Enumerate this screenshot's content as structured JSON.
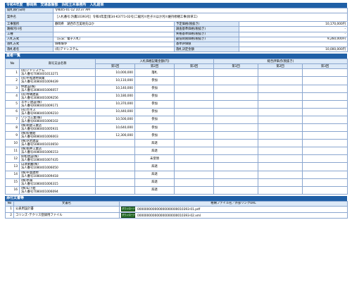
{
  "page_title": "令和4年度　静岡県　交通基盤部　浜松土木事務所　入札結果",
  "info": {
    "rows": [
      {
        "l1": "開札執行日時",
        "v1": "令和05-01-12 10:37 AM",
        "l2": "",
        "v2": "",
        "span": true
      },
      {
        "l1": "案件名",
        "v1": "［入札番号:浜農10393号］令和4年度[第34-K3771-02号]二級河川世子川ほか河川維持修繕工事(除草工)",
        "l2": "",
        "v2": "",
        "span": true,
        "tall": true
      },
      {
        "l1": "工事箇所",
        "v1": "静岡県　湖西市吉美地先ほか",
        "l2": "予定価格(税抜き)",
        "v2": "10,170,000円"
      },
      {
        "l1": "路線河川名",
        "v1": "",
        "l2": "調査基準価格(税抜き)",
        "v2": "-"
      },
      {
        "l1": "工種",
        "v1": "",
        "l2": "失格基準価格(税抜き)",
        "v2": "-"
      },
      {
        "l1": "入札方式",
        "v1": "（方法：電子入札）",
        "l2": "最低制限価格(税抜き)",
        "v2": "9,260,000円"
      },
      {
        "l1": "落札方式",
        "v1": "価格競争",
        "l2": "基準評価値",
        "v2": ""
      },
      {
        "l1": "落札者名",
        "v1": "(有)アドシステム",
        "l2": "落札決定金額",
        "v2": "10,000,000円"
      }
    ]
  },
  "bidders_section": {
    "title": "業者一覧",
    "col_no": "No",
    "col_name": "商号又は名称",
    "col_bid_group": "入札価格記載金額(円)",
    "col_eval_group": "総合評価点(税抜き)",
    "col_first": "第1回",
    "col_second": "第2回",
    "col_third": "第3回",
    "rows": [
      {
        "no": "1",
        "name": "(有)アドシステム",
        "corp": "法人番号7080401013271",
        "amount": "10,000,000",
        "result": "落札"
      },
      {
        "no": "2",
        "name": "(有)平松建材興業",
        "corp": "法人番号3080401009439",
        "amount": "10,110,000",
        "result": "参加"
      },
      {
        "no": "3",
        "name": "伸建設(株)",
        "corp": "法人番号3080401006057",
        "amount": "10,140,000",
        "result": "参加"
      },
      {
        "no": "4",
        "name": "(有)寺嶋建築",
        "corp": "法人番号3080401009256",
        "amount": "10,180,000",
        "result": "参加"
      },
      {
        "no": "5",
        "name": "エボシ建設(株)",
        "corp": "法人番号6080401009171",
        "amount": "10,370,000",
        "result": "参加"
      },
      {
        "no": "6",
        "name": "(有)カネス",
        "corp": "法人番号9080401009210",
        "amount": "10,440,000",
        "result": "参加"
      },
      {
        "no": "7",
        "name": "ワンゴ工業(株)",
        "corp": "法人番号6080401006102",
        "amount": "10,500,000",
        "result": "参加"
      },
      {
        "no": "8",
        "name": "(株)岡倉工業店",
        "corp": "法人番号6080401005931",
        "amount": "10,640,000",
        "result": "参加"
      },
      {
        "no": "9",
        "name": "(株)鈴嘉組",
        "corp": "法人番号8080401006003",
        "amount": "12,300,000",
        "result": "参加"
      },
      {
        "no": "10",
        "name": "(株)浜岩建設",
        "corp": "法人番号5080401010650",
        "amount": "",
        "result": "辞退"
      },
      {
        "no": "11",
        "name": "(株)角井工業店",
        "corp": "法人番号4080401006153",
        "amount": "",
        "result": "辞退"
      },
      {
        "no": "12",
        "name": "鈴松建設(株)",
        "corp": "法人番号1080401007435",
        "amount": "",
        "result": "未受領"
      },
      {
        "no": "13",
        "name": "白須楽園(株)",
        "corp": "法人番号1080401006050",
        "amount": "",
        "result": "辞退"
      },
      {
        "no": "14",
        "name": "(株)平賀建材",
        "corp": "法人番号1080401009418",
        "amount": "",
        "result": "辞退"
      },
      {
        "no": "15",
        "name": "(株)水陽",
        "corp": "法人番号1080401006315",
        "amount": "",
        "result": "辞退"
      },
      {
        "no": "16",
        "name": "(株)山下組",
        "corp": "法人番号7080401006094",
        "amount": "",
        "result": "辞退"
      }
    ]
  },
  "docs_section": {
    "title": "添付文書等",
    "col_no": "No",
    "col_name": "文書名",
    "col_file": "格納ファイル名／外部リンクURL",
    "download_label": "ダウンロード",
    "rows": [
      {
        "no": "1",
        "name": "公表用設計書",
        "file": "000000000000000000000010393-01.pdf"
      },
      {
        "no": "2",
        "name": "コリンズ･テクリス登録用ファイル",
        "file": "000000000000000000000010393-02.xml"
      }
    ]
  }
}
